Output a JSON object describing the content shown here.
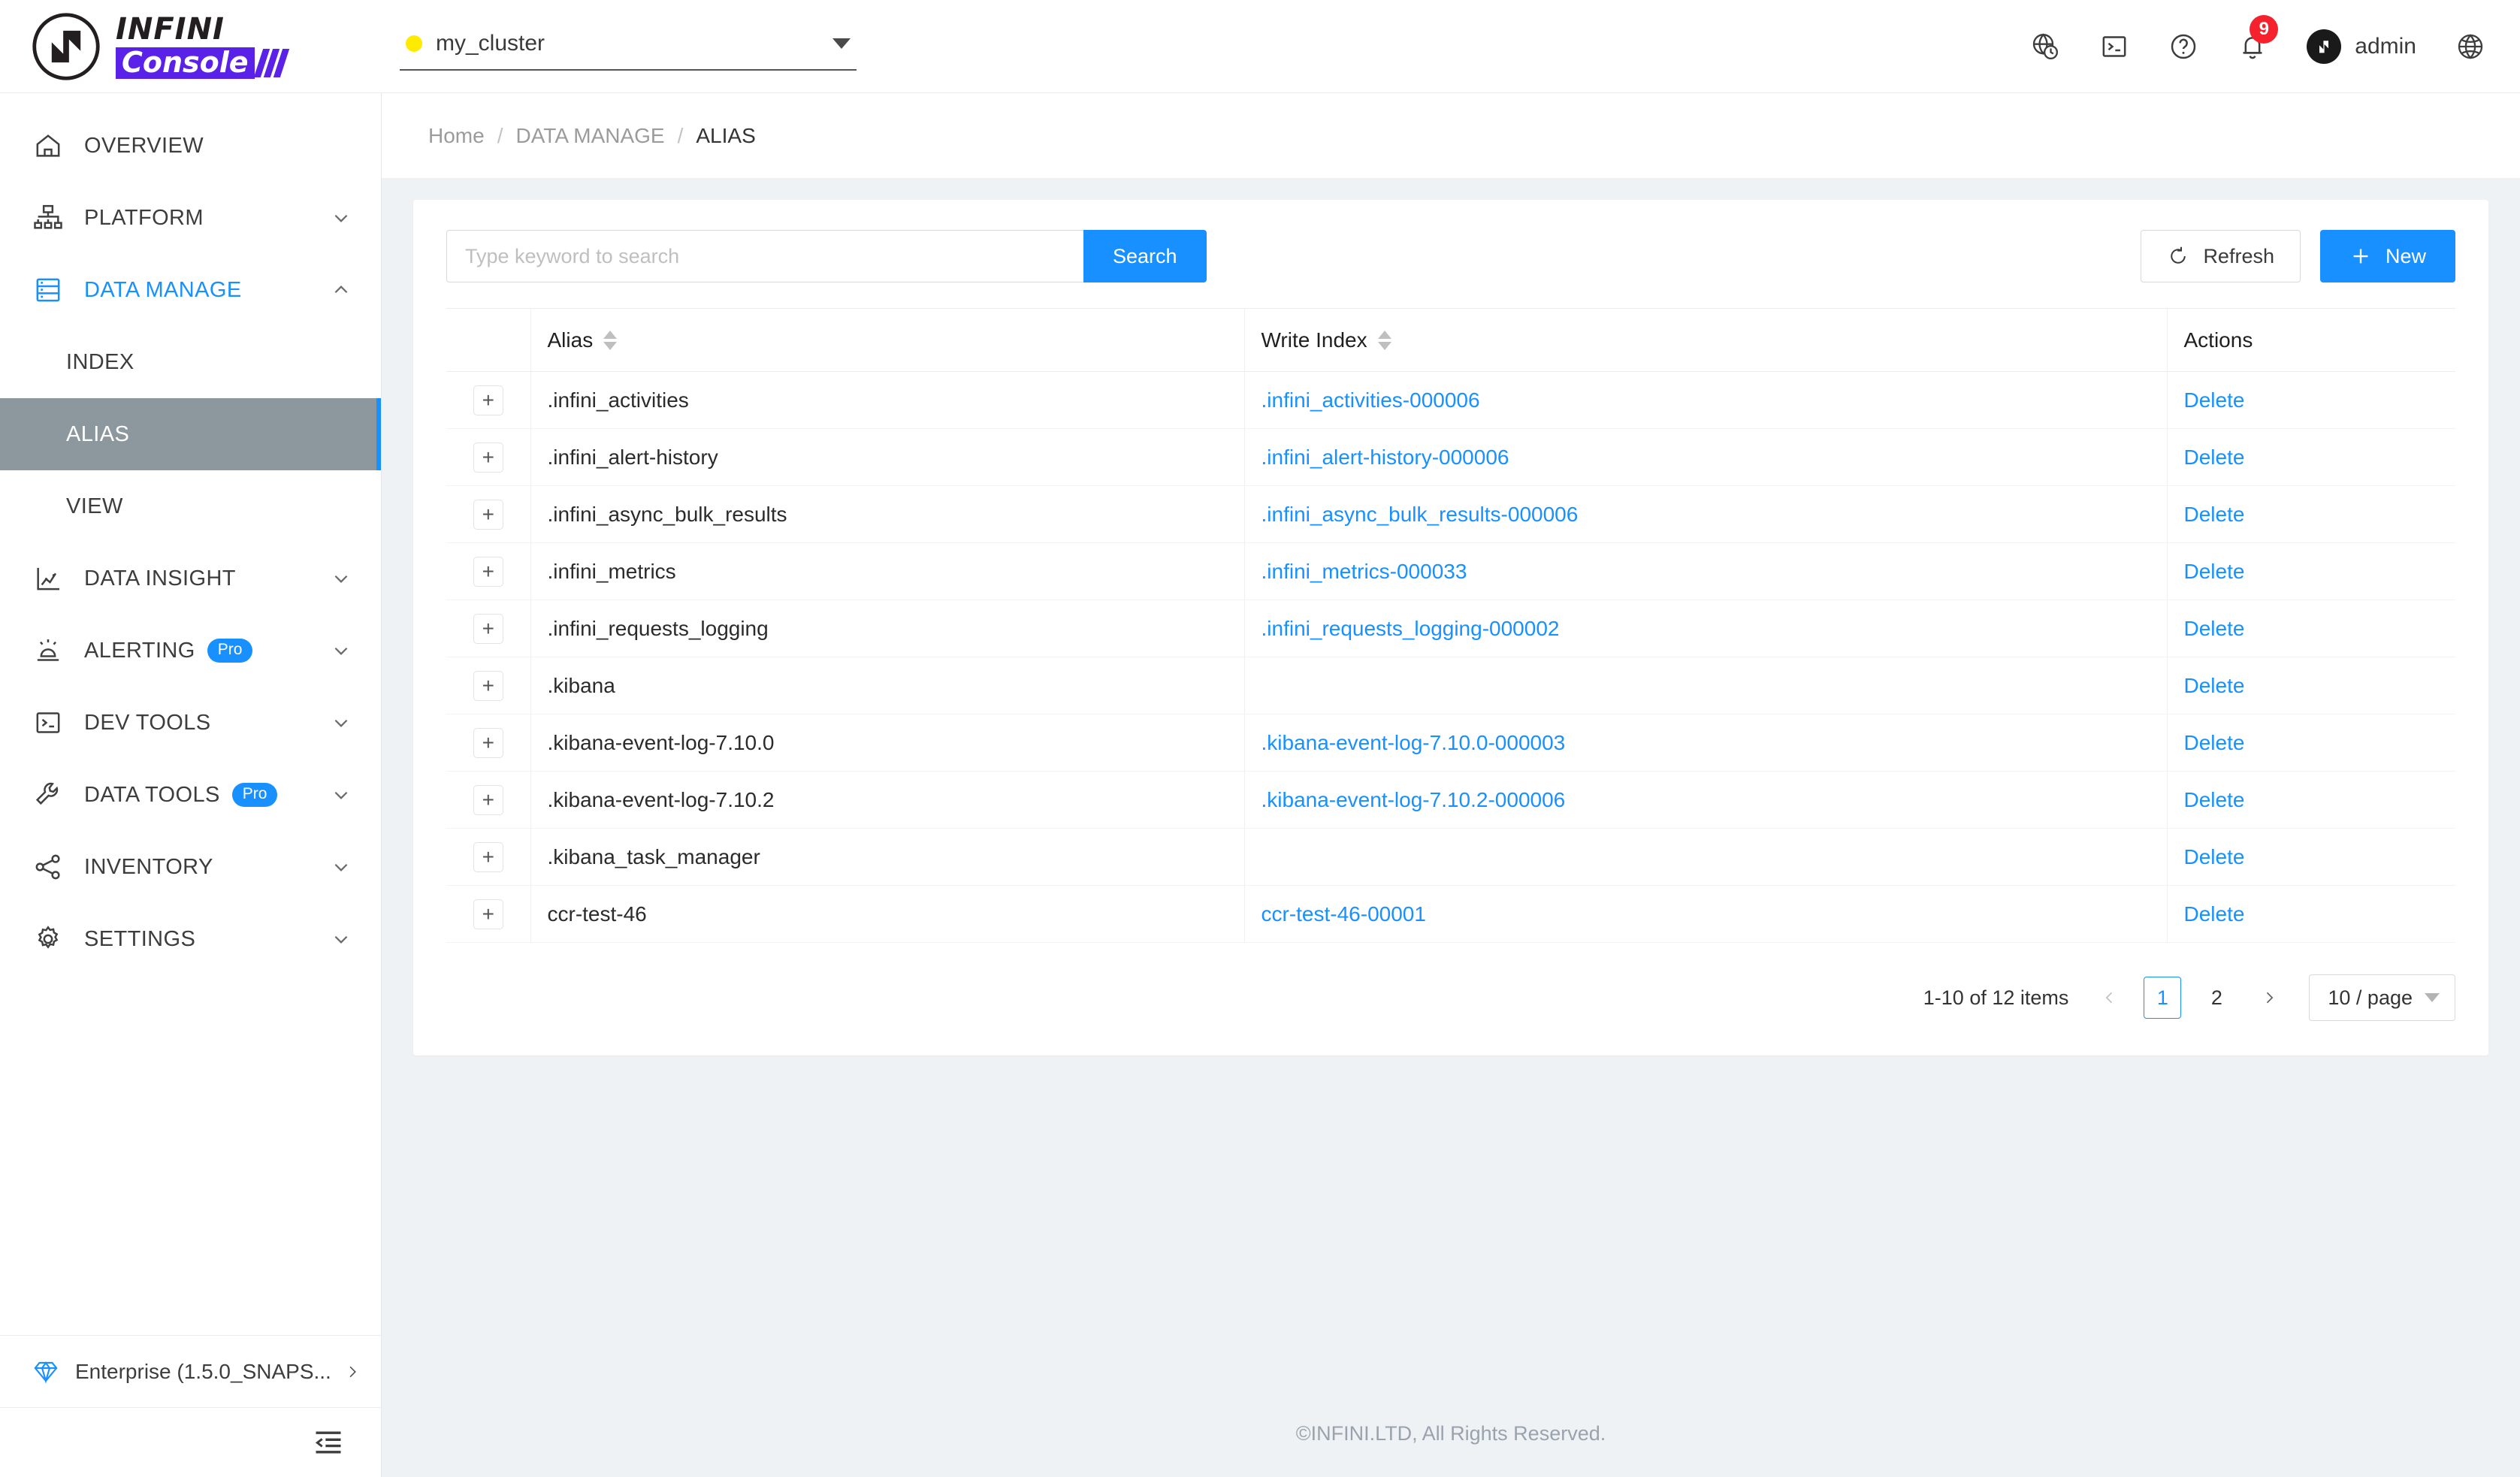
{
  "header": {
    "logo": {
      "top": "INFINI",
      "bottom": "Console"
    },
    "cluster": {
      "name": "my_cluster",
      "status_color": "#ffeb00"
    },
    "icons": [
      {
        "name": "globe-clock-icon"
      },
      {
        "name": "console-terminal-icon"
      },
      {
        "name": "help-circle-icon"
      },
      {
        "name": "bell-icon",
        "badge": "9"
      }
    ],
    "user": "admin",
    "language_icon": "globe-icon",
    "badge_color": "#f5222d"
  },
  "sidebar": {
    "items": [
      {
        "label": "OVERVIEW",
        "icon": "home-icon",
        "expandable": false
      },
      {
        "label": "PLATFORM",
        "icon": "platform-icon",
        "expandable": true,
        "expanded": false
      },
      {
        "label": "DATA MANAGE",
        "icon": "database-icon",
        "expandable": true,
        "expanded": true,
        "active": true
      },
      {
        "label": "DATA INSIGHT",
        "icon": "chart-icon",
        "expandable": true,
        "expanded": false
      },
      {
        "label": "ALERTING",
        "icon": "alarm-icon",
        "expandable": true,
        "badge": "Pro"
      },
      {
        "label": "DEV TOOLS",
        "icon": "terminal-icon",
        "expandable": true
      },
      {
        "label": "DATA TOOLS",
        "icon": "wrench-icon",
        "expandable": true,
        "badge": "Pro"
      },
      {
        "label": "INVENTORY",
        "icon": "share-nodes-icon",
        "expandable": true
      },
      {
        "label": "SETTINGS",
        "icon": "gear-icon",
        "expandable": true
      }
    ],
    "sub_items": [
      {
        "label": "INDEX",
        "selected": false
      },
      {
        "label": "ALIAS",
        "selected": true
      },
      {
        "label": "VIEW",
        "selected": false
      }
    ],
    "enterprise": {
      "label": "Enterprise (1.5.0_SNAPS...",
      "icon": "gem-icon"
    },
    "collapse_icon": "menu-fold-icon",
    "active_color": "#1890ff",
    "selected_bg": "#8c989e"
  },
  "breadcrumb": {
    "items": [
      "Home",
      "DATA MANAGE",
      "ALIAS"
    ],
    "separator": "/"
  },
  "toolbar": {
    "search_placeholder": "Type keyword to search",
    "search_value": "",
    "search_button": "Search",
    "refresh_button": "Refresh",
    "new_button": "New"
  },
  "table": {
    "columns": [
      {
        "key": "expand",
        "label": "",
        "sortable": false
      },
      {
        "key": "alias",
        "label": "Alias",
        "sortable": true
      },
      {
        "key": "write_index",
        "label": "Write Index",
        "sortable": true
      },
      {
        "key": "actions",
        "label": "Actions",
        "sortable": false
      }
    ],
    "expand_glyph": "+",
    "rows": [
      {
        "alias": ".infini_activities",
        "write_index": ".infini_activities-000006",
        "action": "Delete"
      },
      {
        "alias": ".infini_alert-history",
        "write_index": ".infini_alert-history-000006",
        "action": "Delete"
      },
      {
        "alias": ".infini_async_bulk_results",
        "write_index": ".infini_async_bulk_results-000006",
        "action": "Delete"
      },
      {
        "alias": ".infini_metrics",
        "write_index": ".infini_metrics-000033",
        "action": "Delete"
      },
      {
        "alias": ".infini_requests_logging",
        "write_index": ".infini_requests_logging-000002",
        "action": "Delete"
      },
      {
        "alias": ".kibana",
        "write_index": "",
        "action": "Delete"
      },
      {
        "alias": ".kibana-event-log-7.10.0",
        "write_index": ".kibana-event-log-7.10.0-000003",
        "action": "Delete"
      },
      {
        "alias": ".kibana-event-log-7.10.2",
        "write_index": ".kibana-event-log-7.10.2-000006",
        "action": "Delete"
      },
      {
        "alias": ".kibana_task_manager",
        "write_index": "",
        "action": "Delete"
      },
      {
        "alias": "ccr-test-46",
        "write_index": "ccr-test-46-00001",
        "action": "Delete"
      }
    ]
  },
  "pagination": {
    "summary": "1-10 of 12 items",
    "pages": [
      "1",
      "2"
    ],
    "current_page": "1",
    "page_size": "10 / page",
    "prev_enabled": false,
    "next_enabled": true
  },
  "footer": {
    "text": "©INFINI.LTD, All Rights Reserved."
  },
  "colors": {
    "accent": "#1890ff",
    "link": "#1890ff",
    "page_bg": "#eff2f5",
    "brand_purple": "#5a21e8"
  }
}
